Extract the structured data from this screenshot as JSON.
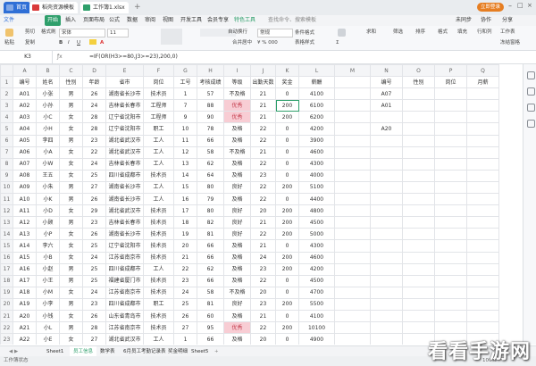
{
  "titlebar": {
    "tabs": [
      {
        "label": "首页",
        "color": "#2f6fd6"
      },
      {
        "label": "稻壳资源模板",
        "color": "#d93a3a"
      },
      {
        "label": "工作簿1.xlsx",
        "color": "#2e9f6b"
      }
    ],
    "login_label": "立即登录"
  },
  "menubar": {
    "file_label": "文件",
    "items": [
      "开始",
      "插入",
      "页面布局",
      "公式",
      "数据",
      "审阅",
      "视图",
      "开发工具",
      "会员专享",
      "特色工具"
    ],
    "search_placeholder": "查找命令、搜索模板",
    "right_items": [
      "未同步",
      "协作",
      "分享"
    ]
  },
  "ribbon": {
    "labels": [
      "粘贴",
      "剪切",
      "复制",
      "格式刷",
      "宋体",
      "11",
      "合并居中",
      "自动换行",
      "常规",
      "条件格式",
      "表格样式",
      "求和",
      "筛选",
      "排序",
      "格式",
      "填充",
      "行和列",
      "工作表",
      "冻结窗格"
    ]
  },
  "formula_bar": {
    "cell_ref": "K3",
    "formula": "=IF(OR(H3>=80,J3>=23),200,0)"
  },
  "columns": [
    "A",
    "B",
    "C",
    "D",
    "E",
    "F",
    "G",
    "H",
    "I",
    "J",
    "K",
    "L",
    "M",
    "N",
    "O",
    "P",
    "Q"
  ],
  "headers": [
    "编号",
    "姓名",
    "性别",
    "年龄",
    "省市",
    "岗位",
    "工号",
    "考核成绩",
    "等级",
    "出勤天数",
    "奖金",
    "薪酬",
    "",
    "编号",
    "性别",
    "岗位",
    "月薪"
  ],
  "rows": [
    [
      "A01",
      "小张",
      "男",
      "26",
      "湖南省长沙市",
      "技术员",
      "1",
      "57",
      "不及格",
      "21",
      "0",
      "4100"
    ],
    [
      "A02",
      "小孙",
      "男",
      "24",
      "吉林省长春市",
      "工程师",
      "7",
      "88",
      "优秀",
      "21",
      "200",
      "6100"
    ],
    [
      "A03",
      "小C",
      "女",
      "28",
      "辽宁省沈阳市",
      "工程师",
      "9",
      "90",
      "优秀",
      "21",
      "200",
      "6200"
    ],
    [
      "A04",
      "小H",
      "女",
      "28",
      "辽宁省沈阳市",
      "职工",
      "10",
      "78",
      "及格",
      "22",
      "0",
      "4200"
    ],
    [
      "A05",
      "李四",
      "男",
      "23",
      "湖北省武汉市",
      "工人",
      "11",
      "66",
      "及格",
      "22",
      "0",
      "3900"
    ],
    [
      "A06",
      "小A",
      "女",
      "22",
      "湖北省武汉市",
      "工人",
      "12",
      "58",
      "不及格",
      "21",
      "0",
      "4600"
    ],
    [
      "A07",
      "小W",
      "女",
      "24",
      "吉林省长春市",
      "工人",
      "13",
      "62",
      "及格",
      "22",
      "0",
      "4300"
    ],
    [
      "A08",
      "王五",
      "女",
      "25",
      "四川省成都市",
      "技术员",
      "14",
      "64",
      "及格",
      "23",
      "0",
      "4000"
    ],
    [
      "A09",
      "小朱",
      "男",
      "27",
      "湖南省长沙市",
      "工人",
      "15",
      "80",
      "良好",
      "22",
      "200",
      "5100"
    ],
    [
      "A10",
      "小K",
      "男",
      "26",
      "湖南省长沙市",
      "工人",
      "16",
      "79",
      "及格",
      "22",
      "0",
      "4400"
    ],
    [
      "A11",
      "小D",
      "女",
      "29",
      "湖北省武汉市",
      "技术员",
      "17",
      "80",
      "良好",
      "20",
      "200",
      "4800"
    ],
    [
      "A12",
      "小顾",
      "男",
      "23",
      "吉林省长春市",
      "技术员",
      "18",
      "82",
      "良好",
      "21",
      "200",
      "4500"
    ],
    [
      "A13",
      "小P",
      "女",
      "26",
      "湖南省长沙市",
      "技术员",
      "19",
      "81",
      "良好",
      "22",
      "200",
      "5000"
    ],
    [
      "A14",
      "李六",
      "女",
      "25",
      "辽宁省沈阳市",
      "技术员",
      "20",
      "66",
      "及格",
      "21",
      "0",
      "4300"
    ],
    [
      "A15",
      "小B",
      "女",
      "24",
      "江苏省南京市",
      "技术员",
      "21",
      "66",
      "及格",
      "24",
      "200",
      "4600"
    ],
    [
      "A16",
      "小赵",
      "男",
      "25",
      "四川省成都市",
      "工人",
      "22",
      "62",
      "及格",
      "23",
      "200",
      "4200"
    ],
    [
      "A17",
      "小王",
      "男",
      "25",
      "福建省厦门市",
      "技术员",
      "23",
      "66",
      "及格",
      "22",
      "0",
      "4500"
    ],
    [
      "A18",
      "小M",
      "女",
      "24",
      "江苏省南京市",
      "技术员",
      "24",
      "58",
      "不及格",
      "20",
      "0",
      "4700"
    ],
    [
      "A19",
      "小李",
      "男",
      "23",
      "四川省成都市",
      "职工",
      "25",
      "81",
      "良好",
      "23",
      "200",
      "5500"
    ],
    [
      "A20",
      "小钱",
      "女",
      "26",
      "山东省青岛市",
      "技术员",
      "26",
      "60",
      "及格",
      "21",
      "0",
      "4100"
    ],
    [
      "A21",
      "小L",
      "男",
      "28",
      "江苏省南京市",
      "技术员",
      "27",
      "95",
      "优秀",
      "22",
      "200",
      "10100"
    ],
    [
      "A22",
      "小E",
      "女",
      "27",
      "湖北省武汉市",
      "工人",
      "1",
      "66",
      "及格",
      "20",
      "0",
      "4900"
    ],
    [
      "A23",
      "赵七",
      "女",
      "21",
      "贵州省贵阳市",
      "工人",
      "2",
      "64",
      "及格",
      "21",
      "0",
      "4600"
    ],
    [
      "A24",
      "小F",
      "男",
      "22",
      "山东省青岛市",
      "工人",
      "3",
      "62",
      "及格",
      "22",
      "0",
      "3800"
    ]
  ],
  "side_table": {
    "values": [
      "A07",
      "A01",
      "",
      "A20"
    ]
  },
  "sheets": [
    "Sheet1",
    "员工信息",
    "数学表",
    "6月员工考勤记录表",
    "奖金明细",
    "Sheet5"
  ],
  "status_bar": {
    "left": "工作簿状态",
    "zoom": "100%"
  },
  "watermark": "看看手游网",
  "colors": {
    "accent": "#2e9f6b",
    "highlight_pink": "#f8cdd4",
    "title_bg": "#e9ecef"
  }
}
